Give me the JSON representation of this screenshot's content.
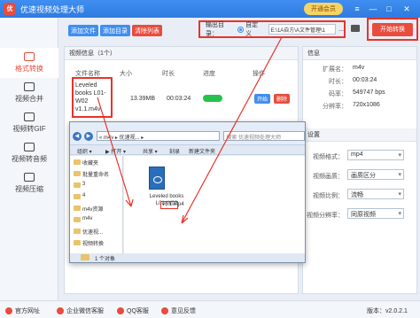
{
  "app": {
    "title": "优速视频处理大师",
    "vip_label": "开通会员"
  },
  "window_controls": {
    "menu": "≡",
    "minimize": "—",
    "maximize": "□",
    "close": "✕"
  },
  "sidebar": {
    "items": [
      {
        "label": "格式转换",
        "active": true
      },
      {
        "label": "视频合并"
      },
      {
        "label": "视频转GIF"
      },
      {
        "label": "视频转音频"
      },
      {
        "label": "视频压缩"
      }
    ]
  },
  "toolbar": {
    "add_file": "添加文件",
    "add_folder": "添加目录",
    "clear_list": "清除列表",
    "output_label": "输出目录：",
    "custom_label": "自定义",
    "output_path": "E:\\1A自方\\A文件管理\\1",
    "more": "...",
    "convert": "开始转换"
  },
  "annotations": {
    "one": "1",
    "two": "2"
  },
  "video_panel": {
    "title": "视频信息（1个）",
    "columns": {
      "name": "文件名称",
      "size": "大小",
      "duration": "时长",
      "progress": "进度",
      "ops": "操作"
    },
    "row": {
      "name": "Leveled books L01-W02 v1.1.m4v",
      "size": "13.39MB",
      "duration": "00:03:24",
      "start": "开始",
      "delete": "删除"
    }
  },
  "info_panel": {
    "title": "信息",
    "rows": [
      {
        "label": "扩展名：",
        "value": "m4v"
      },
      {
        "label": "时长：",
        "value": "00:03:24"
      },
      {
        "label": "码率：",
        "value": "549747 bps"
      },
      {
        "label": "分辨率：",
        "value": "720x1086"
      }
    ]
  },
  "settings_panel": {
    "title": "设置",
    "rows": [
      {
        "label": "视频格式：",
        "value": "mp4"
      },
      {
        "label": "视频画质：",
        "value": "画质区分"
      },
      {
        "label": "视频比例：",
        "value": "流畅"
      },
      {
        "label": "视频分辨率：",
        "value": "同原视频"
      }
    ]
  },
  "explorer": {
    "address": "« m4v ▸ 优速视... ▸",
    "search_placeholder": "搜索 优速视频处理大师",
    "toolbar": {
      "organize": "组织 ▾",
      "open": "▶ 打开 ▾",
      "share": "共享 ▾",
      "burn": "刻录",
      "new_folder": "新建文件夹"
    },
    "tree": [
      "收藏夹",
      "批量重命名",
      "3",
      "4",
      "m4v资源",
      "m4v",
      "优速视...",
      "视频转换"
    ],
    "file": {
      "name_prefix": "Leveled books L01-W02",
      "name_ext": "v1.1.mp4"
    },
    "status": "1 个对象"
  },
  "statusbar": {
    "website": "官方网址",
    "wechat": "企业微信客服",
    "qq": "QQ客服",
    "feedback": "意见反馈",
    "version": "版本：v2.0.2.1"
  },
  "colors": {
    "accent_blue": "#3f8ef0",
    "accent_red": "#e84c3d",
    "annotation_red": "#e8332a",
    "success_green": "#27c24c"
  }
}
